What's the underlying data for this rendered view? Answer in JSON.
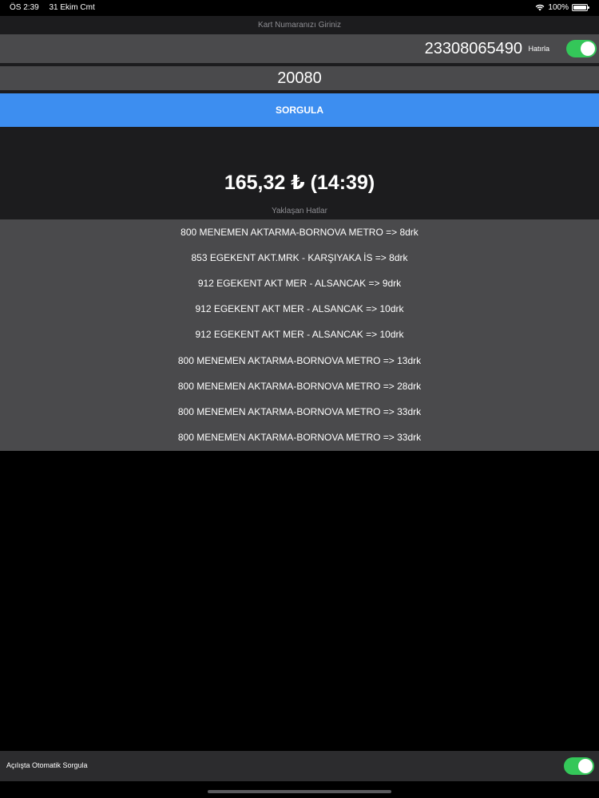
{
  "status_bar": {
    "time": "ÖS 2:39",
    "date": "31 Ekim Cmt",
    "battery": "100%"
  },
  "card": {
    "label": "Kart Numaranızı Giriniz",
    "number": "23308065490",
    "remember_label": "Hatırla",
    "remember_on": true
  },
  "stop_code": "20080",
  "query_button": "SORGULA",
  "balance": "165,32 ₺ (14:39)",
  "upcoming_label": "Yaklaşan Hatlar",
  "lines": [
    "800 MENEMEN AKTARMA-BORNOVA METRO => 8drk",
    "853 EGEKENT AKT.MRK - KARŞIYAKA İS => 8drk",
    "912 EGEKENT AKT MER - ALSANCAK => 9drk",
    "912 EGEKENT AKT MER - ALSANCAK => 10drk",
    "912 EGEKENT AKT MER - ALSANCAK => 10drk",
    "800 MENEMEN AKTARMA-BORNOVA METRO => 13drk",
    "800 MENEMEN AKTARMA-BORNOVA METRO => 28drk",
    "800 MENEMEN AKTARMA-BORNOVA METRO => 33drk",
    "800 MENEMEN AKTARMA-BORNOVA METRO => 33drk"
  ],
  "auto_query": {
    "label": "Açılışta Otomatik Sorgula",
    "on": true
  },
  "icons": {
    "wifi": "wifi-icon",
    "battery": "battery-icon"
  },
  "colors": {
    "accent_blue": "#3d8ef0",
    "toggle_green": "#34c759",
    "row_gray": "#4a4a4c"
  }
}
